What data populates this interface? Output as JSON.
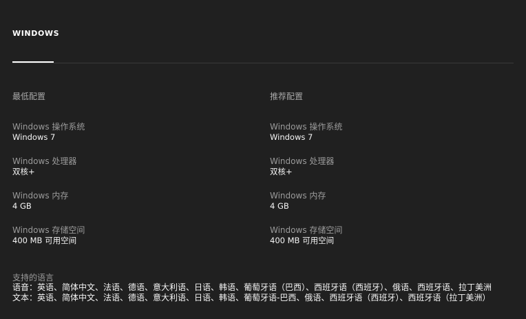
{
  "tabs": [
    {
      "label": "WINDOWS"
    }
  ],
  "minimum": {
    "title": "最低配置",
    "specs": [
      {
        "label": "Windows 操作系统",
        "value": "Windows 7"
      },
      {
        "label": "Windows 处理器",
        "value": "双核+"
      },
      {
        "label": "Windows 内存",
        "value": "4 GB"
      },
      {
        "label": "Windows 存储空间",
        "value": "400 MB 可用空间"
      }
    ]
  },
  "recommended": {
    "title": "推荐配置",
    "specs": [
      {
        "label": "Windows 操作系统",
        "value": "Windows 7"
      },
      {
        "label": "Windows 处理器",
        "value": "双核+"
      },
      {
        "label": "Windows 内存",
        "value": "4 GB"
      },
      {
        "label": "Windows 存储空间",
        "value": "400 MB 可用空间"
      }
    ]
  },
  "languages": {
    "title": "支持的语言",
    "audio": "语音：英语、简体中文、法语、德语、意大利语、日语、韩语、葡萄牙语（巴西）、西班牙语（西班牙）、俄语、西班牙语、拉丁美洲",
    "text": "文本：英语、简体中文、法语、德语、意大利语、日语、韩语、葡萄牙语-巴西、俄语、西班牙语（西班牙）、西班牙语（拉丁美洲）"
  }
}
